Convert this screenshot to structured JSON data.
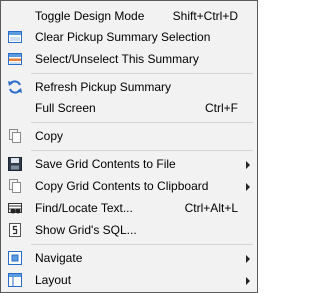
{
  "menu": {
    "items": [
      {
        "label": "Toggle Design Mode",
        "shortcut": "Shift+Ctrl+D",
        "icon": "none"
      },
      {
        "label": "Clear Pickup Summary Selection",
        "shortcut": "",
        "icon": "clear-selection-icon"
      },
      {
        "label": "Select/Unselect This Summary",
        "shortcut": "",
        "icon": "select-summary-icon"
      },
      {
        "label": "Refresh Pickup Summary",
        "shortcut": "",
        "icon": "refresh-icon"
      },
      {
        "label": "Full Screen",
        "shortcut": "Ctrl+F",
        "icon": "none"
      },
      {
        "label": "Copy",
        "shortcut": "",
        "icon": "copy-icon"
      },
      {
        "label": "Save Grid Contents to File",
        "shortcut": "",
        "icon": "save-icon",
        "submenu": true
      },
      {
        "label": "Copy Grid Contents to Clipboard",
        "shortcut": "",
        "icon": "clipboard-icon",
        "submenu": true
      },
      {
        "label": "Find/Locate Text...",
        "shortcut": "Ctrl+Alt+L",
        "icon": "binoculars-icon"
      },
      {
        "label": "Show Grid's SQL...",
        "shortcut": "",
        "icon": "sql-icon"
      },
      {
        "label": "Navigate",
        "shortcut": "",
        "icon": "navigate-icon",
        "submenu": true
      },
      {
        "label": "Layout",
        "shortcut": "",
        "icon": "layout-icon",
        "submenu": true
      }
    ]
  },
  "colors": {
    "menu_bg": "#f2f2f2",
    "border": "#5a5a5a",
    "separator": "#d4d4d4",
    "accent_blue": "#2a6cc9"
  }
}
